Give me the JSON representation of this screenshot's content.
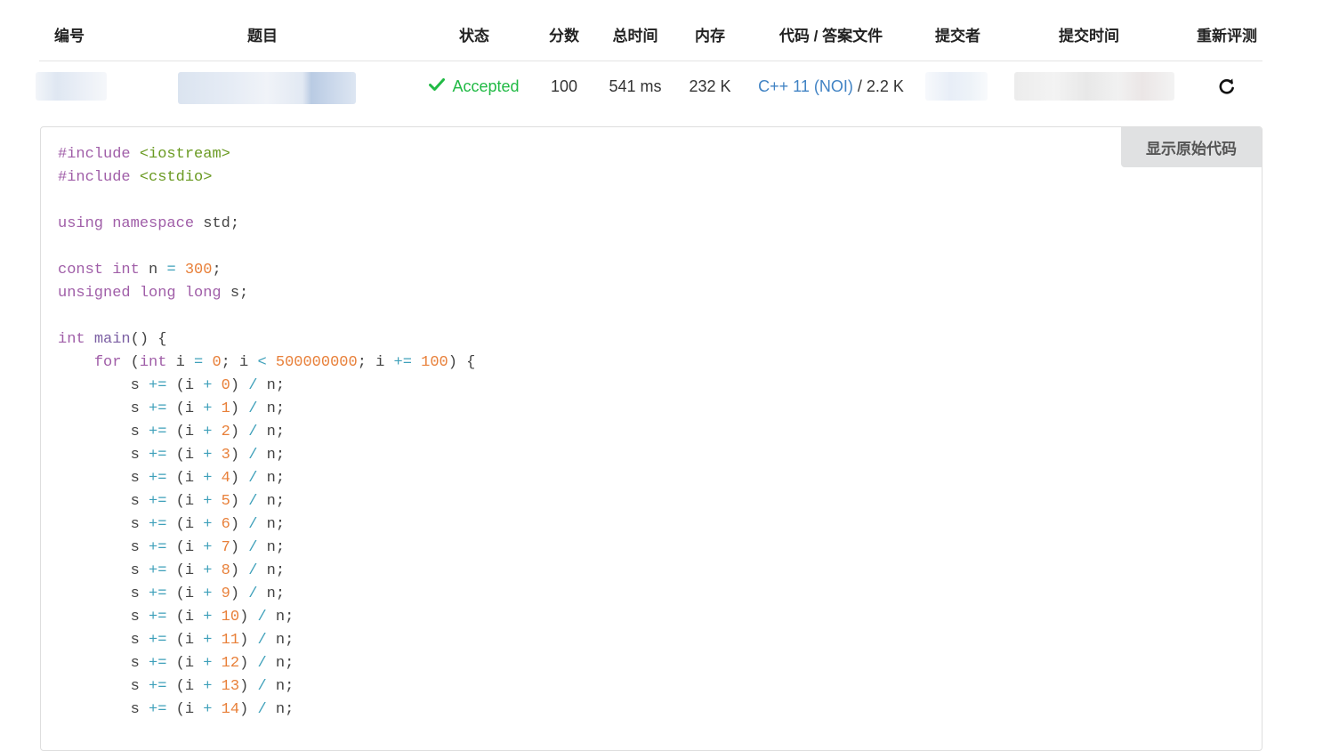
{
  "table": {
    "headers": {
      "id": "编号",
      "title": "题目",
      "status": "状态",
      "score": "分数",
      "time": "总时间",
      "memory": "内存",
      "code": "代码 / 答案文件",
      "submitter": "提交者",
      "submit_time": "提交时间",
      "rejudge": "重新评测"
    },
    "row": {
      "status": "Accepted",
      "score": "100",
      "time": "541 ms",
      "memory": "232 K",
      "language": "C++ 11 (NOI)",
      "separator": " / ",
      "code_size": "2.2 K"
    }
  },
  "buttons": {
    "show_raw": "显示原始代码"
  },
  "colors": {
    "accepted": "#21ba45",
    "link": "#4183c4",
    "keyword": "#a05ea8",
    "number": "#e8803a",
    "operator": "#3ea0ba",
    "string": "#6a9a22"
  },
  "icons": {
    "status": "check-icon",
    "rejudge": "refresh-icon"
  },
  "code": {
    "lines": [
      [
        [
          "pp",
          "#include "
        ],
        [
          "str",
          "<iostream>"
        ]
      ],
      [
        [
          "pp",
          "#include "
        ],
        [
          "str",
          "<cstdio>"
        ]
      ],
      [],
      [
        [
          "kw",
          "using namespace "
        ],
        [
          "t",
          "std;"
        ]
      ],
      [],
      [
        [
          "kw",
          "const int "
        ],
        [
          "t",
          "n "
        ],
        [
          "op",
          "="
        ],
        [
          "t",
          " "
        ],
        [
          "num",
          "300"
        ],
        [
          "t",
          ";"
        ]
      ],
      [
        [
          "kw",
          "unsigned long long "
        ],
        [
          "t",
          "s;"
        ]
      ],
      [],
      [
        [
          "kw",
          "int "
        ],
        [
          "kw2",
          "main"
        ],
        [
          "t",
          "() {"
        ]
      ],
      [
        [
          "t",
          "    "
        ],
        [
          "kw",
          "for "
        ],
        [
          "t",
          "("
        ],
        [
          "kw",
          "int "
        ],
        [
          "t",
          "i "
        ],
        [
          "op",
          "="
        ],
        [
          "t",
          " "
        ],
        [
          "num",
          "0"
        ],
        [
          "t",
          "; i "
        ],
        [
          "op",
          "<"
        ],
        [
          "t",
          " "
        ],
        [
          "num",
          "500000000"
        ],
        [
          "t",
          "; i "
        ],
        [
          "op",
          "+="
        ],
        [
          "t",
          " "
        ],
        [
          "num",
          "100"
        ],
        [
          "t",
          ") {"
        ]
      ],
      [
        [
          "t",
          "        s "
        ],
        [
          "op",
          "+="
        ],
        [
          "t",
          " (i "
        ],
        [
          "op",
          "+"
        ],
        [
          "t",
          " "
        ],
        [
          "num",
          "0"
        ],
        [
          "t",
          ") "
        ],
        [
          "op",
          "/"
        ],
        [
          "t",
          " n;"
        ]
      ],
      [
        [
          "t",
          "        s "
        ],
        [
          "op",
          "+="
        ],
        [
          "t",
          " (i "
        ],
        [
          "op",
          "+"
        ],
        [
          "t",
          " "
        ],
        [
          "num",
          "1"
        ],
        [
          "t",
          ") "
        ],
        [
          "op",
          "/"
        ],
        [
          "t",
          " n;"
        ]
      ],
      [
        [
          "t",
          "        s "
        ],
        [
          "op",
          "+="
        ],
        [
          "t",
          " (i "
        ],
        [
          "op",
          "+"
        ],
        [
          "t",
          " "
        ],
        [
          "num",
          "2"
        ],
        [
          "t",
          ") "
        ],
        [
          "op",
          "/"
        ],
        [
          "t",
          " n;"
        ]
      ],
      [
        [
          "t",
          "        s "
        ],
        [
          "op",
          "+="
        ],
        [
          "t",
          " (i "
        ],
        [
          "op",
          "+"
        ],
        [
          "t",
          " "
        ],
        [
          "num",
          "3"
        ],
        [
          "t",
          ") "
        ],
        [
          "op",
          "/"
        ],
        [
          "t",
          " n;"
        ]
      ],
      [
        [
          "t",
          "        s "
        ],
        [
          "op",
          "+="
        ],
        [
          "t",
          " (i "
        ],
        [
          "op",
          "+"
        ],
        [
          "t",
          " "
        ],
        [
          "num",
          "4"
        ],
        [
          "t",
          ") "
        ],
        [
          "op",
          "/"
        ],
        [
          "t",
          " n;"
        ]
      ],
      [
        [
          "t",
          "        s "
        ],
        [
          "op",
          "+="
        ],
        [
          "t",
          " (i "
        ],
        [
          "op",
          "+"
        ],
        [
          "t",
          " "
        ],
        [
          "num",
          "5"
        ],
        [
          "t",
          ") "
        ],
        [
          "op",
          "/"
        ],
        [
          "t",
          " n;"
        ]
      ],
      [
        [
          "t",
          "        s "
        ],
        [
          "op",
          "+="
        ],
        [
          "t",
          " (i "
        ],
        [
          "op",
          "+"
        ],
        [
          "t",
          " "
        ],
        [
          "num",
          "6"
        ],
        [
          "t",
          ") "
        ],
        [
          "op",
          "/"
        ],
        [
          "t",
          " n;"
        ]
      ],
      [
        [
          "t",
          "        s "
        ],
        [
          "op",
          "+="
        ],
        [
          "t",
          " (i "
        ],
        [
          "op",
          "+"
        ],
        [
          "t",
          " "
        ],
        [
          "num",
          "7"
        ],
        [
          "t",
          ") "
        ],
        [
          "op",
          "/"
        ],
        [
          "t",
          " n;"
        ]
      ],
      [
        [
          "t",
          "        s "
        ],
        [
          "op",
          "+="
        ],
        [
          "t",
          " (i "
        ],
        [
          "op",
          "+"
        ],
        [
          "t",
          " "
        ],
        [
          "num",
          "8"
        ],
        [
          "t",
          ") "
        ],
        [
          "op",
          "/"
        ],
        [
          "t",
          " n;"
        ]
      ],
      [
        [
          "t",
          "        s "
        ],
        [
          "op",
          "+="
        ],
        [
          "t",
          " (i "
        ],
        [
          "op",
          "+"
        ],
        [
          "t",
          " "
        ],
        [
          "num",
          "9"
        ],
        [
          "t",
          ") "
        ],
        [
          "op",
          "/"
        ],
        [
          "t",
          " n;"
        ]
      ],
      [
        [
          "t",
          "        s "
        ],
        [
          "op",
          "+="
        ],
        [
          "t",
          " (i "
        ],
        [
          "op",
          "+"
        ],
        [
          "t",
          " "
        ],
        [
          "num",
          "10"
        ],
        [
          "t",
          ") "
        ],
        [
          "op",
          "/"
        ],
        [
          "t",
          " n;"
        ]
      ],
      [
        [
          "t",
          "        s "
        ],
        [
          "op",
          "+="
        ],
        [
          "t",
          " (i "
        ],
        [
          "op",
          "+"
        ],
        [
          "t",
          " "
        ],
        [
          "num",
          "11"
        ],
        [
          "t",
          ") "
        ],
        [
          "op",
          "/"
        ],
        [
          "t",
          " n;"
        ]
      ],
      [
        [
          "t",
          "        s "
        ],
        [
          "op",
          "+="
        ],
        [
          "t",
          " (i "
        ],
        [
          "op",
          "+"
        ],
        [
          "t",
          " "
        ],
        [
          "num",
          "12"
        ],
        [
          "t",
          ") "
        ],
        [
          "op",
          "/"
        ],
        [
          "t",
          " n;"
        ]
      ],
      [
        [
          "t",
          "        s "
        ],
        [
          "op",
          "+="
        ],
        [
          "t",
          " (i "
        ],
        [
          "op",
          "+"
        ],
        [
          "t",
          " "
        ],
        [
          "num",
          "13"
        ],
        [
          "t",
          ") "
        ],
        [
          "op",
          "/"
        ],
        [
          "t",
          " n;"
        ]
      ],
      [
        [
          "t",
          "        s "
        ],
        [
          "op",
          "+="
        ],
        [
          "t",
          " (i "
        ],
        [
          "op",
          "+"
        ],
        [
          "t",
          " "
        ],
        [
          "num",
          "14"
        ],
        [
          "t",
          ") "
        ],
        [
          "op",
          "/"
        ],
        [
          "t",
          " n;"
        ]
      ]
    ]
  }
}
